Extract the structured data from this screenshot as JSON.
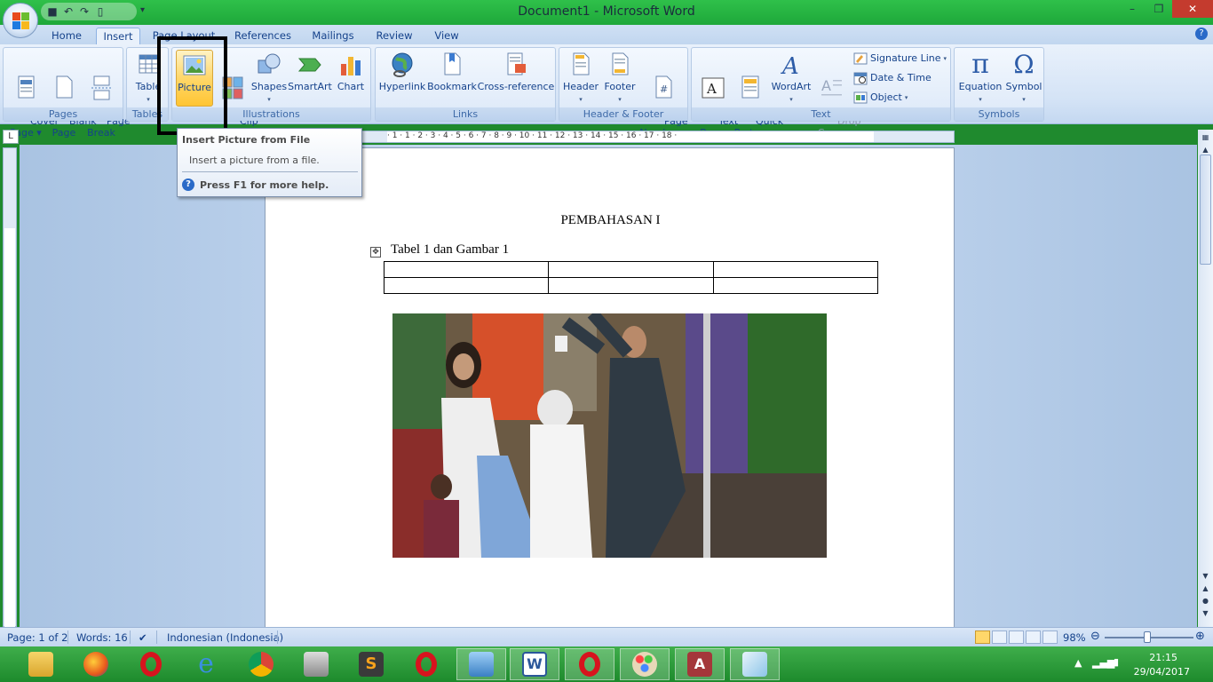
{
  "window": {
    "title": "Document1 - Microsoft Word"
  },
  "tabs": [
    {
      "label": "Home"
    },
    {
      "label": "Insert"
    },
    {
      "label": "Page Layout"
    },
    {
      "label": "References"
    },
    {
      "label": "Mailings"
    },
    {
      "label": "Review"
    },
    {
      "label": "View"
    }
  ],
  "ribbon": {
    "pages": {
      "label": "Pages",
      "cover": "Cover\nPage ▾",
      "blank": "Blank\nPage",
      "break": "Page\nBreak"
    },
    "tables": {
      "label": "Tables",
      "table": "Table"
    },
    "illustrations": {
      "label": "Illustrations",
      "picture": "Picture",
      "clipart": "Clip\nArt",
      "shapes": "Shapes",
      "smartart": "SmartArt",
      "chart": "Chart"
    },
    "links": {
      "label": "Links",
      "hyperlink": "Hyperlink",
      "bookmark": "Bookmark",
      "crossref": "Cross-reference"
    },
    "headerfooter": {
      "label": "Header & Footer",
      "header": "Header",
      "footer": "Footer",
      "pagenumber": "Page\nNumber ▾"
    },
    "text": {
      "label": "Text",
      "textbox": "Text\nBox ▾",
      "quickparts": "Quick\nParts ▾",
      "wordart": "WordArt",
      "dropcap": "Drop\nCap ▾",
      "signature": "Signature Line",
      "datetime": "Date & Time",
      "object": "Object"
    },
    "symbols": {
      "label": "Symbols",
      "equation": "Equation",
      "symbol": "Symbol"
    }
  },
  "tooltip": {
    "title": "Insert Picture from File",
    "description": "Insert a picture from a file.",
    "help": "Press F1 for more help."
  },
  "ruler": {
    "numbers": "· 1 · 1 · 2 · 3 · 4 · 5 · 6 · 7 · 8 · 9 · 10 · 11 · 12 · 13 · 14 · 15 · 16 · 17 · 18 ·"
  },
  "document": {
    "heading": "PEMBAHASAN I",
    "caption": "Tabel 1 dan Gambar 1",
    "table_rows": 2,
    "table_cols": 3
  },
  "status": {
    "page": "Page: 1 of 2",
    "words": "Words: 16",
    "language": "Indonesian (Indonesia)",
    "zoom": "98%"
  },
  "tray": {
    "time": "21:15",
    "date": "29/04/2017"
  },
  "colors": {
    "accent": "#1ea83a",
    "ribbon": "#dce8f8",
    "close": "#c43b2e"
  }
}
